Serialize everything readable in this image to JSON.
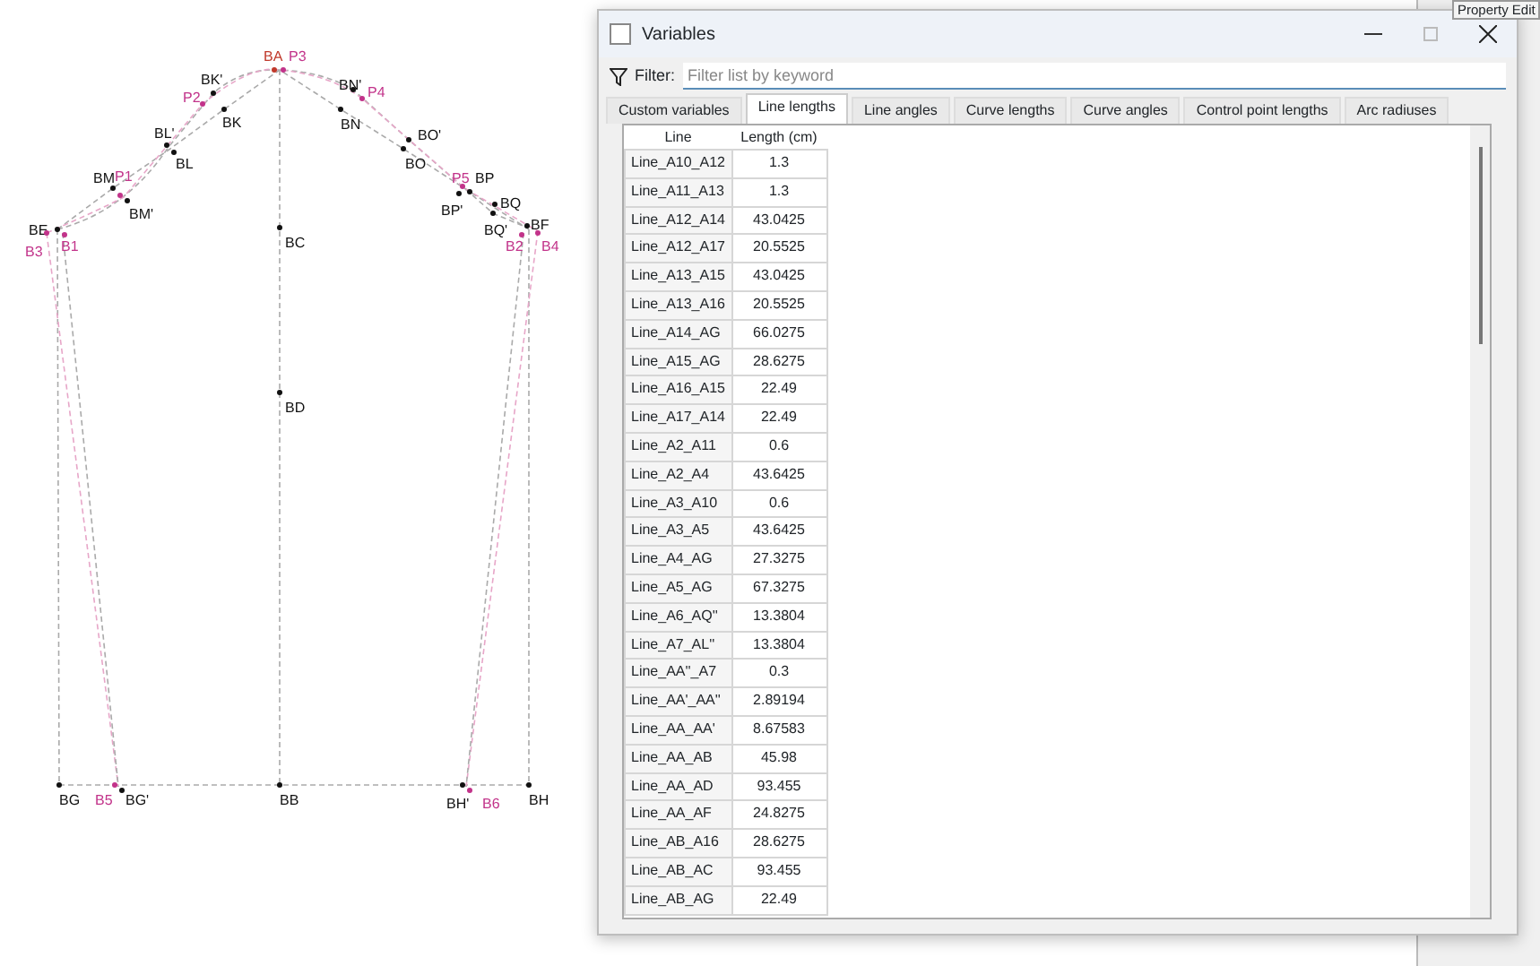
{
  "canvas": {
    "points": [
      {
        "label": "BA",
        "color": "#c0392b"
      },
      {
        "label": "P3",
        "color": "#c2338a"
      },
      {
        "label": "BK'",
        "color": "#111111"
      },
      {
        "label": "P2",
        "color": "#c2338a"
      },
      {
        "label": "BK",
        "color": "#111111"
      },
      {
        "label": "BN'",
        "color": "#111111"
      },
      {
        "label": "P4",
        "color": "#c2338a"
      },
      {
        "label": "BN",
        "color": "#111111"
      },
      {
        "label": "BL'",
        "color": "#111111"
      },
      {
        "label": "BL",
        "color": "#111111"
      },
      {
        "label": "BO'",
        "color": "#111111"
      },
      {
        "label": "BO",
        "color": "#111111"
      },
      {
        "label": "BM",
        "color": "#111111"
      },
      {
        "label": "P1",
        "color": "#c2338a"
      },
      {
        "label": "P5",
        "color": "#c2338a"
      },
      {
        "label": "BP",
        "color": "#111111"
      },
      {
        "label": "BM'",
        "color": "#111111"
      },
      {
        "label": "BP'",
        "color": "#111111"
      },
      {
        "label": "BQ",
        "color": "#111111"
      },
      {
        "label": "BE",
        "color": "#111111"
      },
      {
        "label": "B3",
        "color": "#c2338a"
      },
      {
        "label": "B1",
        "color": "#c2338a"
      },
      {
        "label": "BC",
        "color": "#111111"
      },
      {
        "label": "BQ'",
        "color": "#111111"
      },
      {
        "label": "BF",
        "color": "#111111"
      },
      {
        "label": "B2",
        "color": "#c2338a"
      },
      {
        "label": "B4",
        "color": "#c2338a"
      },
      {
        "label": "BD",
        "color": "#111111"
      },
      {
        "label": "BG",
        "color": "#111111"
      },
      {
        "label": "B5",
        "color": "#c2338a"
      },
      {
        "label": "BG'",
        "color": "#111111"
      },
      {
        "label": "BB",
        "color": "#111111"
      },
      {
        "label": "BH'",
        "color": "#111111"
      },
      {
        "label": "B6",
        "color": "#c2338a"
      },
      {
        "label": "BH",
        "color": "#111111"
      }
    ]
  },
  "background_panel": {
    "title": "Property Edit"
  },
  "window": {
    "title": "Variables",
    "filter": {
      "label": "Filter:",
      "placeholder": "Filter list by keyword"
    },
    "tabs": [
      {
        "label": "Custom variables",
        "selected": false
      },
      {
        "label": "Line lengths",
        "selected": true
      },
      {
        "label": "Line angles",
        "selected": false
      },
      {
        "label": "Curve lengths",
        "selected": false
      },
      {
        "label": "Curve angles",
        "selected": false
      },
      {
        "label": "Control point lengths",
        "selected": false
      },
      {
        "label": "Arc radiuses",
        "selected": false
      }
    ],
    "table": {
      "columns": [
        "Line",
        "Length (cm)"
      ],
      "rows": [
        [
          "Line_A10_A12",
          "1.3"
        ],
        [
          "Line_A11_A13",
          "1.3"
        ],
        [
          "Line_A12_A14",
          "43.0425"
        ],
        [
          "Line_A12_A17",
          "20.5525"
        ],
        [
          "Line_A13_A15",
          "43.0425"
        ],
        [
          "Line_A13_A16",
          "20.5525"
        ],
        [
          "Line_A14_AG",
          "66.0275"
        ],
        [
          "Line_A15_AG",
          "28.6275"
        ],
        [
          "Line_A16_A15",
          "22.49"
        ],
        [
          "Line_A17_A14",
          "22.49"
        ],
        [
          "Line_A2_A11",
          "0.6"
        ],
        [
          "Line_A2_A4",
          "43.6425"
        ],
        [
          "Line_A3_A10",
          "0.6"
        ],
        [
          "Line_A3_A5",
          "43.6425"
        ],
        [
          "Line_A4_AG",
          "27.3275"
        ],
        [
          "Line_A5_AG",
          "67.3275"
        ],
        [
          "Line_A6_AQ''",
          "13.3804"
        ],
        [
          "Line_A7_AL''",
          "13.3804"
        ],
        [
          "Line_AA''_A7",
          "0.3"
        ],
        [
          "Line_AA'_AA''",
          "2.89194"
        ],
        [
          "Line_AA_AA'",
          "8.67583"
        ],
        [
          "Line_AA_AB",
          "45.98"
        ],
        [
          "Line_AA_AD",
          "93.455"
        ],
        [
          "Line_AA_AF",
          "24.8275"
        ],
        [
          "Line_AB_A16",
          "28.6275"
        ],
        [
          "Line_AB_AC",
          "93.455"
        ],
        [
          "Line_AB_AG",
          "22.49"
        ]
      ]
    }
  }
}
